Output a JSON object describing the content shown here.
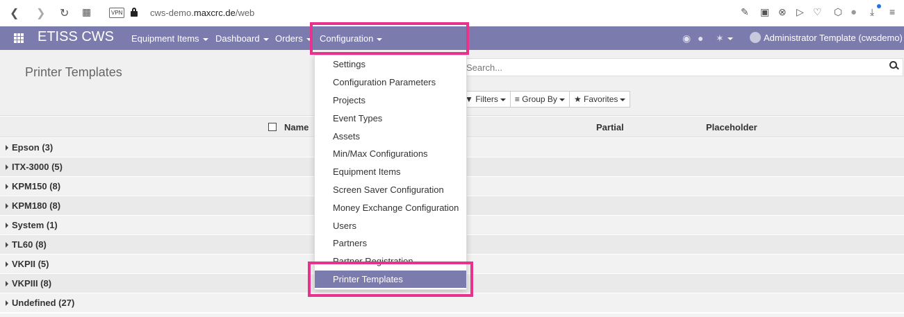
{
  "browser": {
    "vpn": "VPN",
    "url_prefix": "cws-demo.",
    "url_domain": "maxcrc.de",
    "url_path": "/web"
  },
  "navbar": {
    "brand": "ETISS CWS",
    "menus": [
      "Equipment Items",
      "Dashboard",
      "Orders",
      "Configuration"
    ],
    "user": "Administrator Template (cwsdemo)",
    "color": "#7c7bad"
  },
  "control": {
    "title": "Printer Templates",
    "search_placeholder": "Search...",
    "filters": "Filters",
    "group_by": "Group By",
    "favorites": "Favorites"
  },
  "table": {
    "columns": [
      "Name",
      "Partial",
      "Placeholder"
    ],
    "groups": [
      "Epson (3)",
      "ITX-3000 (5)",
      "KPM150 (8)",
      "KPM180 (8)",
      "System (1)",
      "TL60 (8)",
      "VKPII (5)",
      "VKPIII (8)",
      "Undefined (27)"
    ]
  },
  "dropdown": {
    "items": [
      "Settings",
      "Configuration Parameters",
      "Projects",
      "Event Types",
      "Assets",
      "Min/Max Configurations",
      "Equipment Items",
      "Screen Saver Configuration",
      "Money Exchange Configuration",
      "Users",
      "Partners",
      "Partner Registration",
      "Printer Templates"
    ],
    "active": "Printer Templates",
    "highlight_color": "#e8338c"
  }
}
